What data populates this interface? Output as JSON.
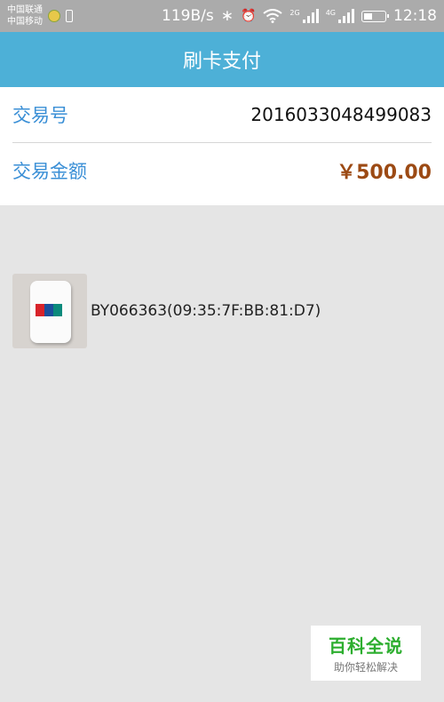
{
  "status_bar": {
    "carrier_top": "中国联通",
    "carrier_bottom": "中国移动",
    "net_speed": "119B/s",
    "bluetooth": "∗",
    "alarm": "⏰",
    "signal1_label": "2G",
    "signal2_label": "4G",
    "time": "12:18"
  },
  "header": {
    "title": "刷卡支付"
  },
  "transaction": {
    "number_label": "交易号",
    "number_value": "2016033048499083",
    "amount_label": "交易金额",
    "amount_value": "￥500.00"
  },
  "device": {
    "name": "BY066363(09:35:7F:BB:81:D7)"
  },
  "watermark": {
    "title": "百科全说",
    "subtitle": "助你轻松解决"
  },
  "colors": {
    "header_bg": "#4db0d7",
    "label_blue": "#3a8fd6",
    "amount_brown": "#9c4a14",
    "watermark_green": "#2dae2f"
  }
}
